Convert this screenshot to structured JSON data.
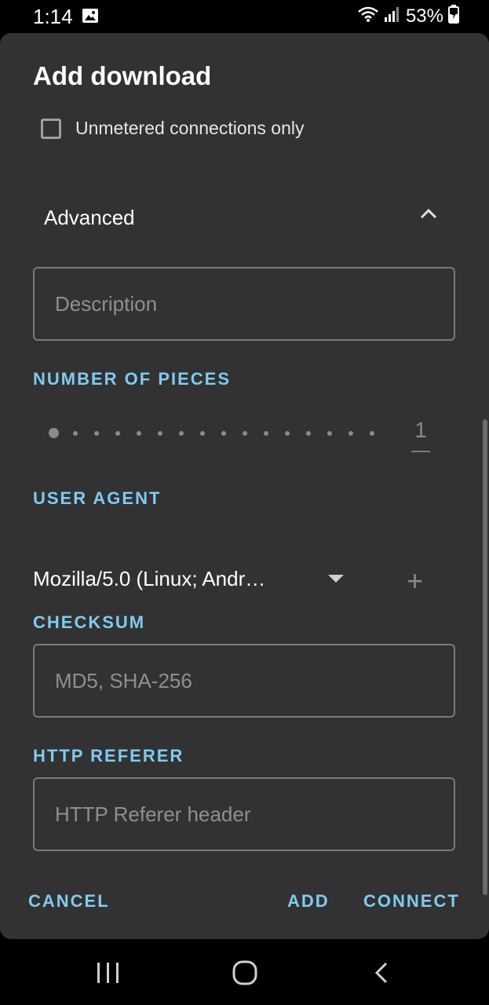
{
  "status": {
    "time": "1:14",
    "battery": "53%",
    "icons": [
      "image-icon",
      "wifi-icon",
      "signal-icon",
      "battery-icon"
    ]
  },
  "dialog": {
    "title": "Add download",
    "metered_label": "Unmetered connections only",
    "metered_checked": false,
    "advanced_label": "Advanced",
    "description_placeholder": "Description",
    "description_value": "",
    "pieces_label": "NUMBER OF PIECES",
    "pieces_value": "1",
    "user_agent_label": "USER AGENT",
    "user_agent_value": "Mozilla/5.0 (Linux; Andr…",
    "checksum_label": "CHECKSUM",
    "checksum_placeholder": "MD5, SHA-256",
    "referer_label": "HTTP REFERER",
    "referer_placeholder": "HTTP Referer header",
    "buttons": {
      "cancel": "CANCEL",
      "add": "ADD",
      "connect": "CONNECT"
    }
  },
  "colors": {
    "accent": "#7fcbf0",
    "dialog_bg": "#323232",
    "system_bar": "#000000"
  }
}
